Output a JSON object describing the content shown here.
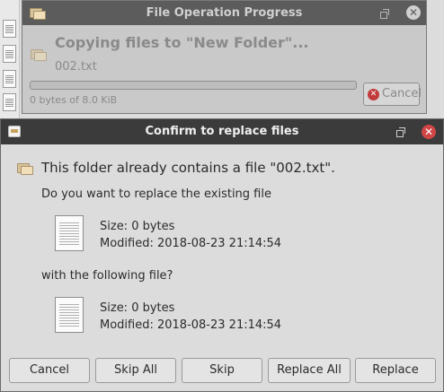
{
  "progress_window": {
    "title": "File Operation Progress",
    "heading": "Copying files to \"New Folder\"...",
    "current_file": "002.txt",
    "status": "0 bytes of 8.0 KiB",
    "progress_fraction": 0,
    "cancel_label": "Cancel"
  },
  "confirm_window": {
    "title": "Confirm to replace files",
    "heading": "This folder already contains a file \"002.txt\".",
    "question_existing": "Do you want to replace the existing file",
    "existing_file": {
      "size": "Size: 0 bytes",
      "modified": "Modified: 2018-08-23 21:14:54"
    },
    "question_new": "with the following file?",
    "new_file": {
      "size": "Size: 0 bytes",
      "modified": "Modified: 2018-08-23 21:14:54"
    },
    "buttons": {
      "cancel": "Cancel",
      "skip_all": "Skip All",
      "skip": "Skip",
      "replace_all": "Replace All",
      "replace": "Replace"
    }
  },
  "colors": {
    "accent_close": "#c23b3b",
    "progress_titlebar": "#5c5c5c",
    "confirm_titlebar": "#3b3b3b"
  },
  "icons": [
    "folder-icon",
    "restore-icon",
    "close-icon",
    "stop-icon",
    "text-file-icon",
    "application-icon"
  ]
}
